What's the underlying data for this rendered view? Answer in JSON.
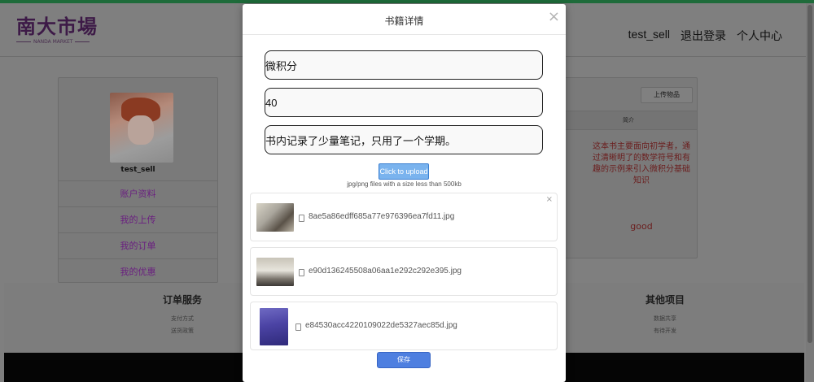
{
  "header": {
    "logo_cn": "南大市場",
    "logo_en": "NANDA MARKET",
    "nav": [
      "test_sell",
      "退出登录",
      "个人中心"
    ]
  },
  "sidebar": {
    "username": "test_sell",
    "items": [
      "账户资料",
      "我的上传",
      "我的订单",
      "我的优惠"
    ]
  },
  "content": {
    "upload_goods_label": "上传物品",
    "column_intro": "简介",
    "description": "这本书主要面向初学者，通过清晰明了的数学符号和有趣的示例来引入微积分基础知识",
    "comment": "good"
  },
  "footer": {
    "col1": {
      "title": "订单服务",
      "links": [
        "支付方式",
        "送货政策"
      ]
    },
    "col2": {
      "title": "其他项目",
      "links": [
        "数据共享",
        "有待开发"
      ]
    }
  },
  "modal": {
    "title": "书籍详情",
    "close_symbol": "×",
    "fields": {
      "name": "微积分",
      "price": "40",
      "note": "书内记录了少量笔记，只用了一个学期。"
    },
    "upload_button": "Click to upload",
    "upload_tip": "jpg/png files with a size less than 500kb",
    "files": [
      "8ae5a86edff685a77e976396ea7fd11.jpg",
      "e90d136245508a06aa1e292c292e395.jpg",
      "e84530acc4220109022de5327aec85d.jpg"
    ],
    "file_close_symbol": "×",
    "save_button": "保存"
  },
  "colors": {
    "overlay": "#7f7f7f",
    "accent_green": "#1e6b3a",
    "menu_purple": "#6a1f80",
    "save_blue": "#4e7fe0",
    "upload_blue": "#7ab3ee"
  }
}
